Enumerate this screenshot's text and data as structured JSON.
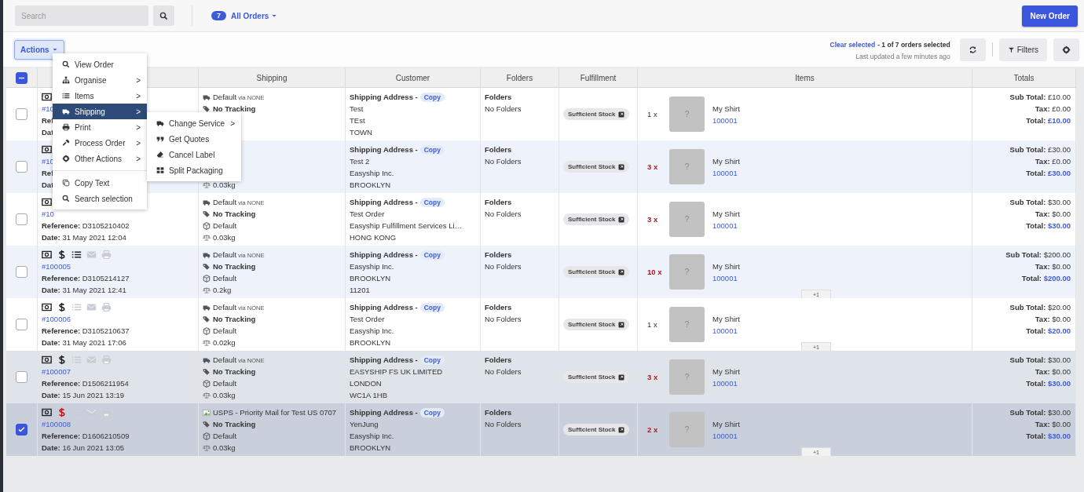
{
  "topbar": {
    "search": {
      "placeholder": "Search"
    },
    "orders_count": "7",
    "orders_filter": "All Orders"
  },
  "new_order_button": "New Order",
  "toolbar": {
    "actions_button": "Actions",
    "clear_selected": "Clear selected",
    "selection_text": " - 1 of 7 orders selected",
    "last_updated": "Last updated a few minutes ago",
    "filters_button": "Filters"
  },
  "table": {
    "select_all": {
      "indeterminate": true
    },
    "columns": [
      {
        "label": "Shipping"
      },
      {
        "label": "Customer"
      },
      {
        "label": "Folders"
      },
      {
        "label": "Fulfillment"
      },
      {
        "label": "Items"
      },
      {
        "label": "Totals"
      }
    ],
    "rows": [
      {
        "selected": false,
        "icons": [
          {
            "kind": "cash",
            "dim": false
          }
        ],
        "order": "#10",
        "reference_label": "Ref",
        "date_label": "Dat",
        "shipping": {
          "kind": "truck",
          "service": "Default",
          "carrier": "via NONE",
          "tracking": "No Tracking"
        },
        "customer": {
          "heading": "Shipping Address -",
          "copy": "Copy",
          "lines": [
            "Test",
            "TEst",
            "TOWN"
          ]
        },
        "folders": {
          "heading": "Folders",
          "value": "No Folders"
        },
        "fulfillment": "Sufficient Stock",
        "item": {
          "qty": "1 x",
          "highlight": false,
          "thumb": "?",
          "name": "My Shirt",
          "sku": "100001"
        },
        "totals": {
          "sub_label": "Sub Total:",
          "sub": "£10.00",
          "tax_label": "Tax:",
          "tax": "£0.00",
          "total_label": "Total:",
          "total": "£10.00"
        }
      },
      {
        "selected": false,
        "icons": [
          {
            "kind": "cash",
            "dim": false
          }
        ],
        "order": "#10",
        "reference_label": "Ref",
        "date_label": "Dat",
        "shipping": {
          "weight": "0.03kg"
        },
        "customer": {
          "heading": "Shipping Address -",
          "copy": "Copy",
          "lines": [
            "Test 2",
            "Easyship Inc.",
            "BROOKLYN"
          ]
        },
        "folders": {
          "heading": "Folders",
          "value": "No Folders"
        },
        "fulfillment": "Sufficient Stock",
        "item": {
          "qty": "3 x",
          "highlight": true,
          "thumb": "?",
          "name": "My Shirt",
          "sku": "100001"
        },
        "totals": {
          "sub_label": "Sub Total:",
          "sub": "£30.00",
          "tax_label": "Tax:",
          "tax": "£0.00",
          "total_label": "Total:",
          "total": "£30.00"
        }
      },
      {
        "selected": false,
        "icons": [
          {
            "kind": "cash",
            "dim": false
          }
        ],
        "order": "#10",
        "reference_label": "Reference:",
        "reference": "D3105210402",
        "date_label": "Date:",
        "date": "31 May 2021 12:04",
        "shipping": {
          "kind": "truck",
          "service": "Default",
          "carrier": "via NONE",
          "tracking": "No Tracking",
          "package": "Default",
          "weight": "0.03kg"
        },
        "customer": {
          "heading": "Shipping Address -",
          "copy": "Copy",
          "lines": [
            "Test Order",
            "Easyship Fulfillment Services Li…",
            "HONG KONG"
          ]
        },
        "folders": {
          "heading": "Folders",
          "value": "No Folders"
        },
        "fulfillment": "Sufficient Stock",
        "item": {
          "qty": "3 x",
          "highlight": true,
          "thumb": "?",
          "name": "My Shirt",
          "sku": "100001"
        },
        "totals": {
          "sub_label": "Sub Total:",
          "sub": "$30.00",
          "tax_label": "Tax:",
          "tax": "$0.00",
          "total_label": "Total:",
          "total": "$30.00"
        }
      },
      {
        "selected": false,
        "icons": [
          {
            "kind": "cash",
            "dim": false
          },
          {
            "kind": "dollar",
            "dim": false,
            "alert": false
          },
          {
            "kind": "list",
            "dim": false
          },
          {
            "kind": "mail",
            "dim": true
          },
          {
            "kind": "print",
            "dim": true
          }
        ],
        "order": "#100005",
        "reference_label": "Reference:",
        "reference": "D3105214127",
        "date_label": "Date:",
        "date": "31 May 2021 12:41",
        "shipping": {
          "kind": "truck",
          "service": "Default",
          "carrier": "via NONE",
          "tracking": "No Tracking",
          "package": "Default",
          "weight": "0.2kg"
        },
        "customer": {
          "heading": "Shipping Address -",
          "copy": "Copy",
          "lines": [
            "Easyship Inc.",
            "BROOKLYN",
            "11201"
          ]
        },
        "folders": {
          "heading": "Folders",
          "value": "No Folders"
        },
        "fulfillment": "Sufficient Stock",
        "item": {
          "qty": "10 x",
          "highlight": true,
          "thumb": "?",
          "name": "My Shirt",
          "sku": "100001",
          "more": "+1"
        },
        "totals": {
          "sub_label": "Sub Total:",
          "sub": "$200.00",
          "tax_label": "Tax:",
          "tax": "$0.00",
          "total_label": "Total:",
          "total": "$200.00"
        }
      },
      {
        "selected": false,
        "icons": [
          {
            "kind": "cash",
            "dim": false
          },
          {
            "kind": "dollar",
            "dim": false,
            "alert": false
          },
          {
            "kind": "list",
            "dim": true
          },
          {
            "kind": "mail",
            "dim": true
          },
          {
            "kind": "print",
            "dim": true
          }
        ],
        "order": "#100006",
        "reference_label": "Reference:",
        "reference": "D3105210637",
        "date_label": "Date:",
        "date": "31 May 2021 17:06",
        "shipping": {
          "kind": "truck",
          "service": "Default",
          "carrier": "via NONE",
          "tracking": "No Tracking",
          "package": "Default",
          "weight": "0.02kg"
        },
        "customer": {
          "heading": "Shipping Address -",
          "copy": "Copy",
          "lines": [
            "Test Order",
            "Easyship Inc.",
            "BROOKLYN"
          ]
        },
        "folders": {
          "heading": "Folders",
          "value": "No Folders"
        },
        "fulfillment": "Sufficient Stock",
        "item": {
          "qty": "1 x",
          "highlight": false,
          "thumb": "?",
          "name": "My Shirt",
          "sku": "100001",
          "more": "+1"
        },
        "totals": {
          "sub_label": "Sub Total:",
          "sub": "$20.00",
          "tax_label": "Tax:",
          "tax": "$0.00",
          "total_label": "Total:",
          "total": "$20.00"
        }
      },
      {
        "selected": false,
        "icons": [
          {
            "kind": "cash",
            "dim": false
          },
          {
            "kind": "dollar",
            "dim": false,
            "alert": false
          },
          {
            "kind": "list",
            "dim": true
          },
          {
            "kind": "mail",
            "dim": true
          },
          {
            "kind": "print",
            "dim": true
          }
        ],
        "order": "#100007",
        "reference_label": "Reference:",
        "reference": "D1506211954",
        "date_label": "Date:",
        "date": "15 Jun 2021 13:19",
        "shipping": {
          "kind": "truck",
          "service": "Default",
          "carrier": "via NONE",
          "tracking": "No Tracking",
          "package": "Default",
          "weight": "0.03kg"
        },
        "customer": {
          "heading": "Shipping Address -",
          "copy": "Copy",
          "lines": [
            "EASYSHIP FS UK LIMITED",
            "LONDON",
            "WC1A 1HB"
          ]
        },
        "folders": {
          "heading": "Folders",
          "value": "No Folders"
        },
        "fulfillment": "Sufficient Stock",
        "item": {
          "qty": "3 x",
          "highlight": true,
          "thumb": "?",
          "name": "My Shirt",
          "sku": "100001"
        },
        "totals": {
          "sub_label": "Sub Total:",
          "sub": "$30.00",
          "tax_label": "Tax:",
          "tax": "$0.00",
          "total_label": "Total:",
          "total": "$30.00"
        }
      },
      {
        "selected": true,
        "icons": [
          {
            "kind": "cash",
            "dim": false
          },
          {
            "kind": "dollar",
            "dim": false,
            "alert": true
          },
          {
            "kind": "list",
            "dim": true
          },
          {
            "kind": "mail",
            "dim": true
          },
          {
            "kind": "print",
            "dim": true
          }
        ],
        "order": "#100008",
        "reference_label": "Reference:",
        "reference": "D1606210509",
        "date_label": "Date:",
        "date": "16 Jun 2021 13:05",
        "shipping": {
          "kind": "image",
          "service": "USPS - Priority Mail for Test US 0707",
          "tracking": "No Tracking",
          "package": "Default",
          "weight": "0.03kg"
        },
        "customer": {
          "heading": "Shipping Address -",
          "copy": "Copy",
          "lines": [
            "YenJung",
            "Easyship Inc.",
            "BROOKLYN"
          ]
        },
        "folders": {
          "heading": "Folders",
          "value": "No Folders"
        },
        "fulfillment": "Sufficient Stock",
        "item": {
          "qty": "2 x",
          "highlight": true,
          "thumb": "?",
          "name": "My Shirt",
          "sku": "100001",
          "more": "+1"
        },
        "totals": {
          "sub_label": "Sub Total:",
          "sub": "$30.00",
          "tax_label": "Tax:",
          "tax": "$0.00",
          "total_label": "Total:",
          "total": "$30.00"
        }
      }
    ]
  },
  "actions_menu": {
    "items": [
      {
        "kind": "search",
        "label": "View Order",
        "selected": false
      },
      {
        "kind": "sitemap",
        "label": "Organise",
        "arrow": ">",
        "selected": false
      },
      {
        "kind": "list",
        "label": "Items",
        "arrow": ">",
        "selected": false
      },
      {
        "kind": "truck",
        "label": "Shipping",
        "arrow": ">",
        "selected": true
      },
      {
        "kind": "print",
        "label": "Print",
        "arrow": ">",
        "selected": false
      },
      {
        "kind": "wrench",
        "label": "Process Order",
        "arrow": ">",
        "selected": false
      },
      {
        "kind": "gear",
        "label": "Other Actions",
        "arrow": ">",
        "selected": false
      },
      {
        "kind": "divider"
      },
      {
        "kind": "copy",
        "label": "Copy Text",
        "selected": false
      },
      {
        "kind": "search",
        "label": "Search selection",
        "selected": false
      }
    ]
  },
  "shipping_submenu": {
    "items": [
      {
        "kind": "truck",
        "label": "Change Service",
        "arrow": ">"
      },
      {
        "kind": "quote",
        "label": "Get Quotes"
      },
      {
        "kind": "eraser",
        "label": "Cancel Label"
      },
      {
        "kind": "grid",
        "label": "Split Packaging"
      }
    ]
  }
}
